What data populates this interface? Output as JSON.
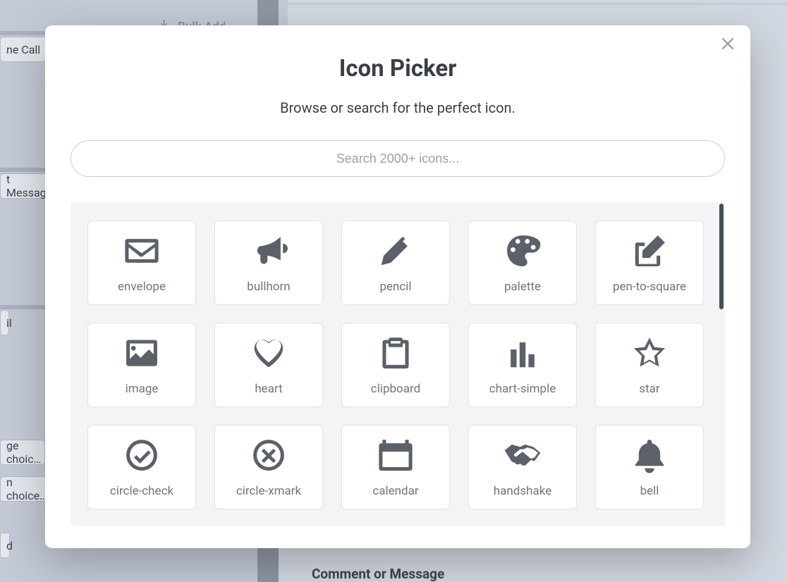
{
  "background": {
    "bulk_add": "Bulk Add",
    "sidebar": {
      "call": "ne Call",
      "message": "t Message",
      "mail": "il",
      "choice1": "ge choic…",
      "choice2": "n choice…",
      "item6": "d"
    },
    "right_field_label": "Comment or Message"
  },
  "modal": {
    "title": "Icon Picker",
    "subtitle": "Browse or search for the perfect icon.",
    "search_placeholder": "Search 2000+ icons...",
    "icons": [
      {
        "name": "envelope",
        "icon": "envelope"
      },
      {
        "name": "bullhorn",
        "icon": "bullhorn"
      },
      {
        "name": "pencil",
        "icon": "pencil"
      },
      {
        "name": "palette",
        "icon": "palette"
      },
      {
        "name": "pen-to-square",
        "icon": "pen-to-square"
      },
      {
        "name": "image",
        "icon": "image"
      },
      {
        "name": "heart",
        "icon": "heart"
      },
      {
        "name": "clipboard",
        "icon": "clipboard"
      },
      {
        "name": "chart-simple",
        "icon": "chart-simple"
      },
      {
        "name": "star",
        "icon": "star"
      },
      {
        "name": "circle-check",
        "icon": "circle-check"
      },
      {
        "name": "circle-xmark",
        "icon": "circle-xmark"
      },
      {
        "name": "calendar",
        "icon": "calendar"
      },
      {
        "name": "handshake",
        "icon": "handshake"
      },
      {
        "name": "bell",
        "icon": "bell"
      }
    ]
  }
}
